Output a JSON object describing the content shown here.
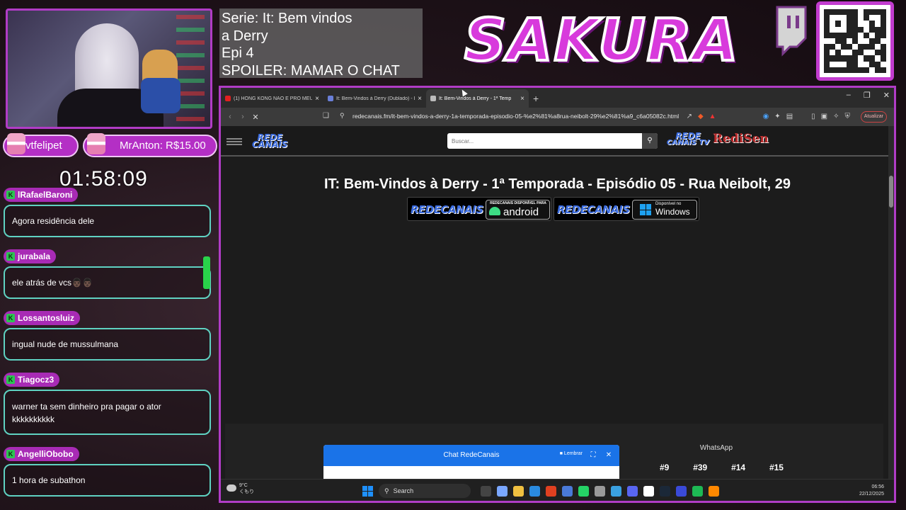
{
  "overlay": {
    "series_lines": [
      "Serie: It: Bem vindos",
      "a Derry",
      "Epi 4",
      "SPOILER: MAMAR O CHAT"
    ],
    "brand_name": "SAKURA",
    "timer": "01:58:09",
    "donors": [
      {
        "text": "vtfelipet"
      },
      {
        "text": "MrAnton: R$15.00"
      }
    ],
    "accent_color": "#b13cc6",
    "chat_border_color": "#5fd2c2"
  },
  "chat": [
    {
      "user": "lRafaelBaroni",
      "message": "Agora residência dele"
    },
    {
      "user": "jurabala",
      "message": "ele atrás de vcs👨🏿👨🏿"
    },
    {
      "user": "Lossantosluiz",
      "message": "ingual nude de mussulmana"
    },
    {
      "user": "Tiagocz3",
      "message": "warner ta sem dinheiro pra pagar o ator kkkkkkkkkk"
    },
    {
      "user": "AngelliObobo",
      "message": "1 hora de subathon"
    }
  ],
  "browser": {
    "tabs": [
      {
        "title": "(1) HONG KONG NÃO É PRO MEU B",
        "active": false,
        "favicon_color": "#e02020"
      },
      {
        "title": "It: Bem-Vindos à Derry (Dublado) - L",
        "active": false,
        "favicon_color": "#6a7fd8"
      },
      {
        "title": "It: Bem-Vindos à Derry - 1ª Temp",
        "active": true,
        "favicon_color": "#bbbbbb"
      }
    ],
    "new_tab": "+",
    "url": "redecanais.fm/it-bem-vindos-a-derry-1a-temporada-episodio-05-%e2%81%a8rua-neibolt-29%e2%81%a9_c6a05082c.html",
    "update_button": "Atualizar",
    "window_controls": [
      "–",
      "❐",
      "✕"
    ]
  },
  "site": {
    "logo_line1": "REDE",
    "logo_line2": "CANAIS",
    "logo_tv_line1": "REDE",
    "logo_tv_line2": "CANAIS TV",
    "logo_tv_badge": "RediSen",
    "search_placeholder": "Buscar...",
    "title": "IT: Bem-Vindos à Derry - 1ª Temporada - Episódio 05 - Rua Neibolt, 29",
    "banner_android": {
      "brand": "REDECANAIS",
      "top": "REDECANAIS DISPONÍVEL PARA",
      "store": "android"
    },
    "banner_windows": {
      "brand": "REDECANAIS",
      "top": "Disponível no",
      "store": "Windows"
    },
    "chat_widget": {
      "title": "Chat RedeCanais",
      "remember": "Lembrar",
      "expand_glyph": "⛶",
      "close_glyph": "✕"
    },
    "whatsapp_label": "WhatsApp",
    "episode_numbers": [
      "#9",
      "#39",
      "#14",
      "#15"
    ]
  },
  "taskbar": {
    "weather_temp": "9°C",
    "weather_desc": "くもり",
    "search_label": "Search",
    "time": "06:56",
    "date": "22/12/2025",
    "icon_colors": [
      "#1e90ff",
      "#444444",
      "#7aa7ff",
      "#f0c040",
      "#2a8be0",
      "#e04020",
      "#4a7ad8",
      "#25d366",
      "#9a9a9a",
      "#3aa0e0",
      "#5865f2",
      "#ffffff",
      "#1b2838",
      "#3a4ad8",
      "#1db954",
      "#ff8800"
    ]
  }
}
